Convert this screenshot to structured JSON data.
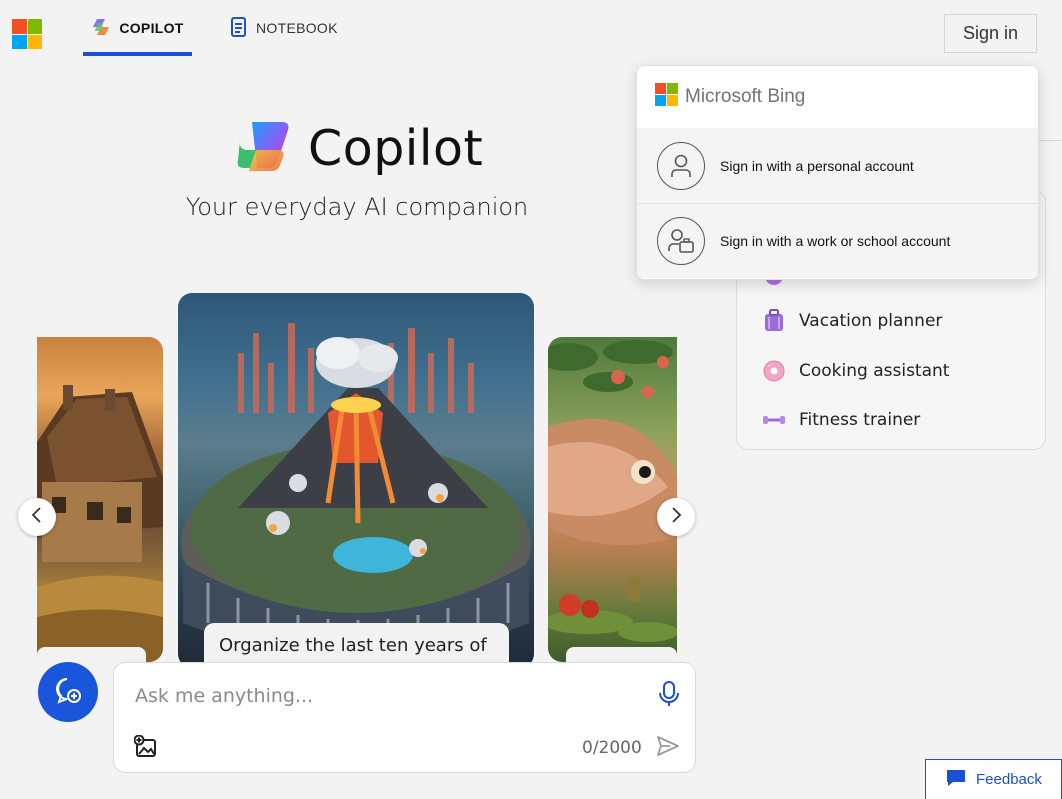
{
  "header": {
    "tabs": [
      {
        "label": "COPILOT",
        "icon": "copilot-icon",
        "active": true
      },
      {
        "label": "NOTEBOOK",
        "icon": "notebook-icon",
        "active": false
      }
    ],
    "sign_in_label": "Sign in"
  },
  "hero": {
    "title": "Copilot",
    "subtitle": "Your everyday AI companion"
  },
  "carousel": {
    "caption": "Organize the last ten years of",
    "prev_icon": "chevron-left-icon",
    "next_icon": "chevron-right-icon"
  },
  "chat": {
    "placeholder": "Ask me anything...",
    "counter": "0/2000"
  },
  "panel": {
    "items": [
      {
        "label": "Vacation planner",
        "icon": "suitcase-icon"
      },
      {
        "label": "Cooking assistant",
        "icon": "donut-icon"
      },
      {
        "label": "Fitness trainer",
        "icon": "dumbbell-icon"
      }
    ]
  },
  "signin_menu": {
    "brand": "Microsoft Bing",
    "options": [
      {
        "label": "Sign in with a personal account",
        "icon": "person-icon"
      },
      {
        "label": "Sign in with a work or school account",
        "icon": "work-person-icon"
      }
    ]
  },
  "feedback_label": "Feedback",
  "colors": {
    "accent": "#1a4fd6",
    "new_topic_button": "#1a56db",
    "ms_red": "#f25022",
    "ms_green": "#7fba00",
    "ms_blue": "#00a4ef",
    "ms_yellow": "#ffb900"
  }
}
